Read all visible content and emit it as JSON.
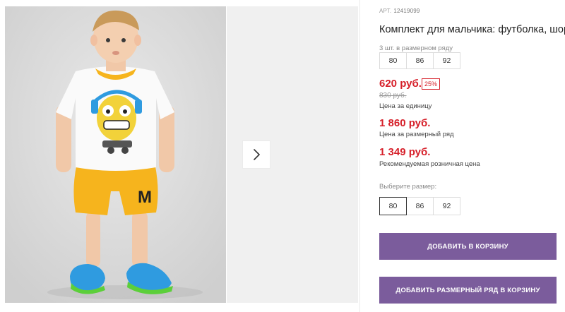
{
  "product": {
    "article_label": "АРТ.",
    "article_number": "12419099",
    "title": "Комплект для мальчика: футболка, шорты"
  },
  "size_range": {
    "label": "3 шт. в размерном ряду",
    "sizes": [
      "80",
      "86",
      "92"
    ]
  },
  "prices": {
    "current": "620 руб.",
    "discount": "25%",
    "old": "830 руб.",
    "unit_label": "Цена за единицу",
    "range_price": "1 860 руб.",
    "range_label": "Цена за размерный ряд",
    "recommended": "1 349 руб.",
    "recommended_label": "Рекомендуемая розничная цена"
  },
  "size_select": {
    "label": "Выберите размер:",
    "options": [
      "80",
      "86",
      "92"
    ],
    "selected": "80"
  },
  "buttons": {
    "add_to_cart": "ДОБАВИТЬ В КОРЗИНУ",
    "add_range_to_cart": "ДОБАВИТЬ РАЗМЕРНЫЙ РЯД В КОРЗИНУ"
  },
  "photo_print_letter": "M",
  "colors": {
    "price_red": "#d6202a",
    "button_purple": "#7b5c9c",
    "shorts_yellow": "#f6b41d"
  },
  "icons": {
    "next": "chevron-right-icon"
  }
}
